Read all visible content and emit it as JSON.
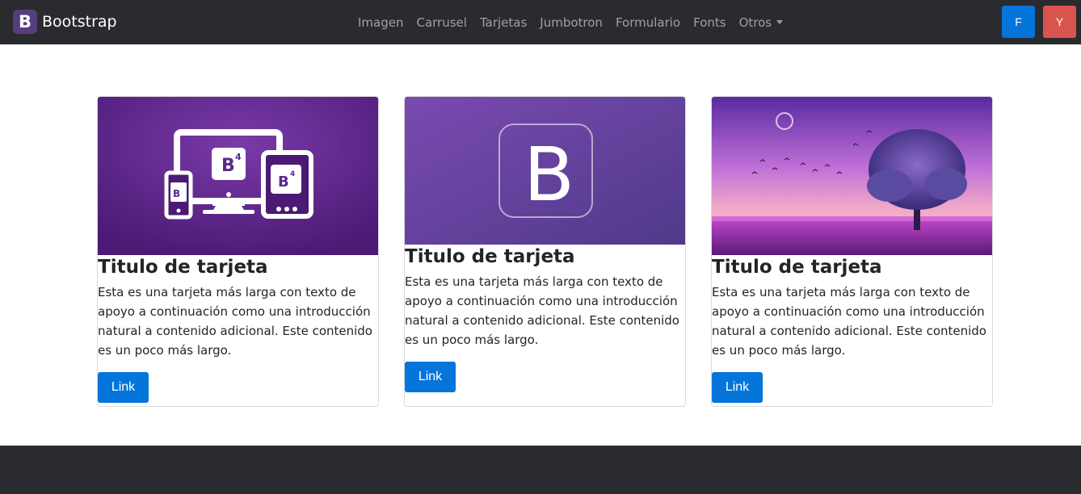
{
  "navbar": {
    "brand_letter": "B",
    "brand_text": "Bootstrap",
    "links": [
      "Imagen",
      "Carrusel",
      "Tarjetas",
      "Jumbotron",
      "Formulario",
      "Fonts",
      "Otros"
    ],
    "btn_f": "F",
    "btn_y": "Y"
  },
  "cards": [
    {
      "title": "Titulo de tarjeta",
      "text": "Esta es una tarjeta más larga con texto de apoyo a continuación como una introducción natural a contenido adicional. Este contenido es un poco más largo.",
      "button": "Link",
      "image": "bootstrap-devices-image",
      "badge_text": "B"
    },
    {
      "title": "Titulo de tarjeta",
      "text": "Esta es una tarjeta más larga con texto de apoyo a continuación como una introducción natural a contenido adicional. Este contenido es un poco más largo.",
      "button": "Link",
      "image": "bootstrap-logo-image",
      "badge_text": "B"
    },
    {
      "title": "Titulo de tarjeta",
      "text": "Esta es una tarjeta más larga con texto de apoyo a continuación como una introducción natural a contenido adicional. Este contenido es un poco más largo.",
      "button": "Link",
      "image": "purple-tree-landscape-image"
    }
  ],
  "colors": {
    "navbar_bg": "#2a2b2e",
    "primary": "#0475db",
    "danger": "#d9534f",
    "bootstrap_purple": "#563d7c"
  }
}
